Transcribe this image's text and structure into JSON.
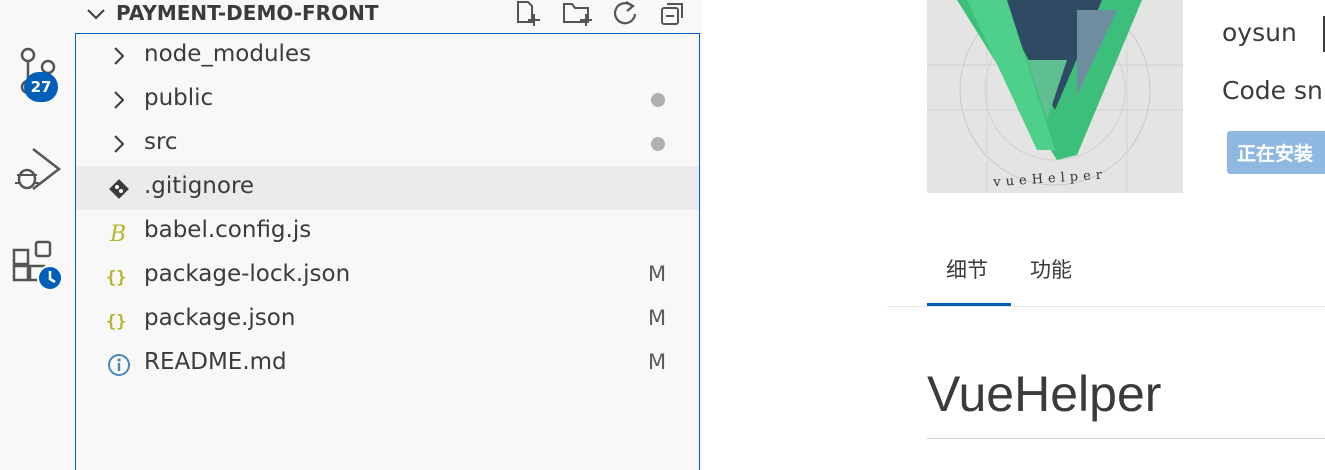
{
  "activity_bar": {
    "source_control_badge": "27",
    "items": [
      "source-control-icon",
      "run-debug-icon",
      "extensions-timeline-icon"
    ]
  },
  "explorer": {
    "section_title": "PAYMENT-DEMO-FRONT",
    "actions": [
      "new-file-icon",
      "new-folder-icon",
      "refresh-icon",
      "collapse-all-icon"
    ],
    "items": [
      {
        "label": "node_modules",
        "type": "folder",
        "status": ""
      },
      {
        "label": "public",
        "type": "folder",
        "status": "dot"
      },
      {
        "label": "src",
        "type": "folder",
        "status": "dot"
      },
      {
        "label": ".gitignore",
        "type": "git-file",
        "status": ""
      },
      {
        "label": "babel.config.js",
        "type": "babel-file",
        "status": ""
      },
      {
        "label": "package-lock.json",
        "type": "json-file",
        "status": "M"
      },
      {
        "label": "package.json",
        "type": "json-file",
        "status": "M"
      },
      {
        "label": "README.md",
        "type": "info-file",
        "status": "M"
      }
    ]
  },
  "extension": {
    "logo_text": "vueHelper",
    "author": "oysun",
    "description": "Code sn",
    "install_button": "正在安装",
    "tabs": [
      "细节",
      "功能"
    ],
    "readme_title": "VueHelper"
  },
  "colors": {
    "accent": "#005fb8",
    "sidebar_bg": "#f8f8f8",
    "modified_dot": "#b0b0b0"
  }
}
